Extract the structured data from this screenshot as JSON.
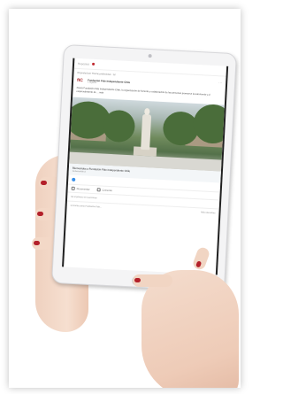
{
  "screen": {
    "topbar_label": "Reposted",
    "post": {
      "reposted_line": "Reposted por Theme profesional · 1d",
      "author_logo": "fIC",
      "author_name": "Fundación Fide Independiente Chile",
      "author_meta": "1 seguidor",
      "text": "Fiesta Fundación Fide Independiente Chile, la organización de fomento y colaboración de las personas promueve la autonomía y el emprendimiento de ... más",
      "link_title": "Bienvenidos a Fundación Fide Independiente Chile",
      "link_source": "fundacionfide.cl",
      "actions": [
        "Recomendar",
        "Comentar"
      ],
      "reactions_summary": "Sé el primero en reaccionar",
      "comment_placeholder": "Comenta como Fundación Fide...",
      "comment_sort": "Más relevantes"
    }
  },
  "colors": {
    "nail": "#b3202a",
    "brand": "#a41e22",
    "like": "#378fe9"
  }
}
